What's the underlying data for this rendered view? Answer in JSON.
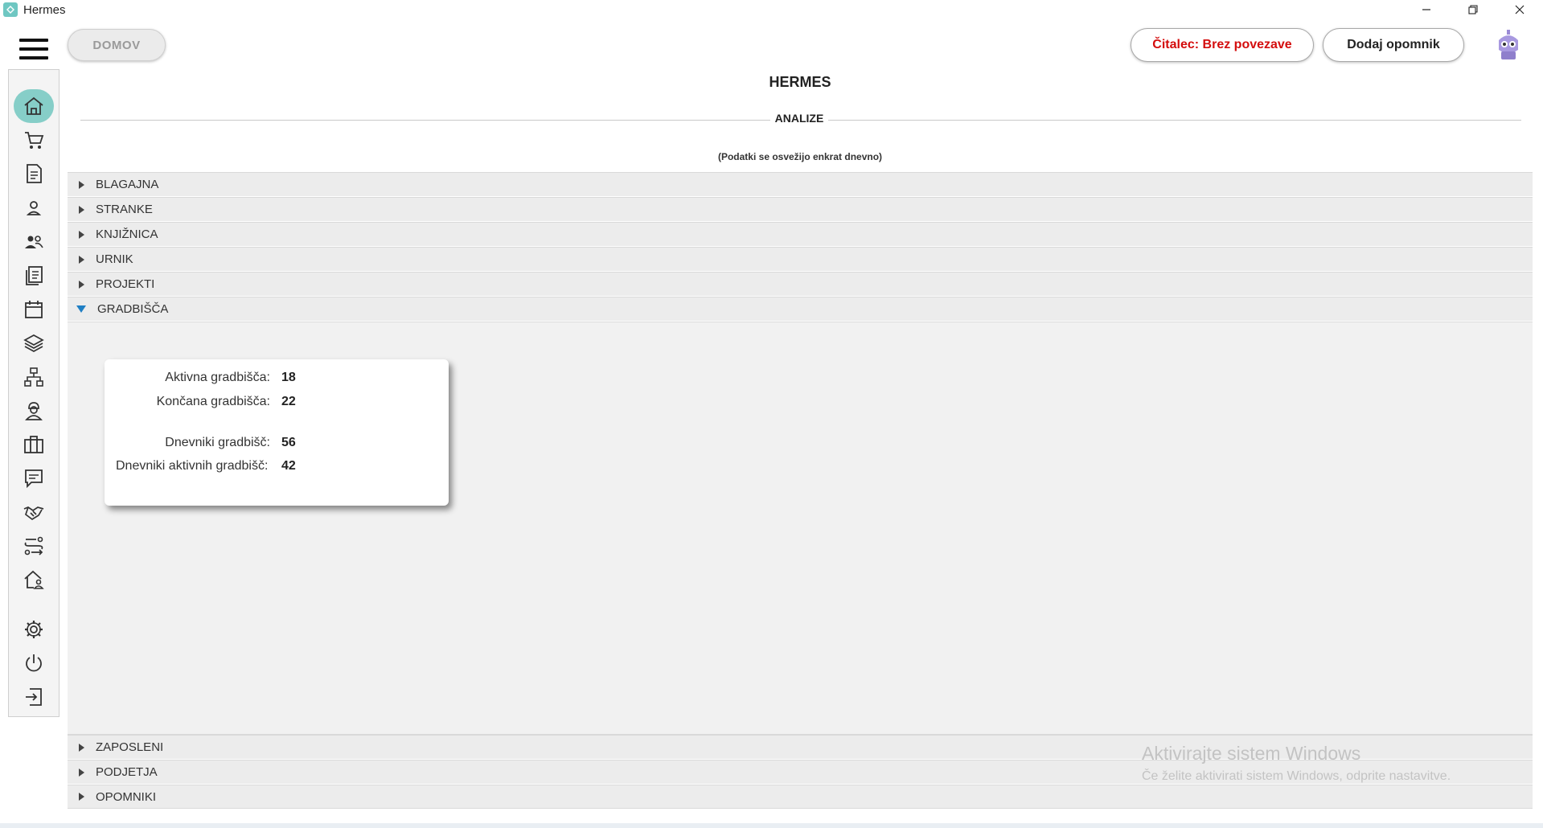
{
  "window": {
    "title": "Hermes"
  },
  "topbar": {
    "home_label": "DOMOV",
    "reader_label": "Čitalec: Brez povezave",
    "reminder_label": "Dodaj opomnik"
  },
  "main": {
    "app_heading": "HERMES",
    "section_label": "ANALIZE",
    "refresh_note": "(Podatki se osvežijo enkrat dnevno)"
  },
  "accordion": {
    "items": [
      {
        "label": "BLAGAJNA",
        "expanded": false
      },
      {
        "label": "STRANKE",
        "expanded": false
      },
      {
        "label": "KNJIŽNICA",
        "expanded": false
      },
      {
        "label": "URNIK",
        "expanded": false
      },
      {
        "label": "PROJEKTI",
        "expanded": false
      },
      {
        "label": "GRADBIŠČA",
        "expanded": true
      },
      {
        "label": "ZAPOSLENI",
        "expanded": false
      },
      {
        "label": "PODJETJA",
        "expanded": false
      },
      {
        "label": "OPOMNIKI",
        "expanded": false
      }
    ]
  },
  "construction_stats": [
    {
      "label": "Aktivna gradbišča:",
      "value": "18"
    },
    {
      "label": "Končana gradbišča:",
      "value": "22"
    },
    {
      "label": "Dnevniki gradbišč:",
      "value": "56"
    },
    {
      "label": "Dnevniki aktivnih gradbišč:",
      "value": "42"
    }
  ],
  "sidebar": {
    "icons": [
      "home-icon",
      "cart-icon",
      "invoice-icon",
      "person-icon",
      "people-icon",
      "documents-icon",
      "calendar-icon",
      "layers-icon",
      "org-chart-icon",
      "worker-icon",
      "briefcase-icon",
      "message-icon",
      "handshake-icon",
      "route-icon",
      "house-user-icon",
      "settings-icon",
      "power-icon",
      "logout-icon"
    ],
    "active": "home-icon"
  },
  "watermark": {
    "title": "Aktivirajte sistem Windows",
    "subtitle": "Če želite aktivirati sistem Windows, odprite nastavitve."
  },
  "colors": {
    "accent": "#86cec8",
    "reader_status": "#d40d0d",
    "expanded_caret": "#1f7fc4"
  }
}
